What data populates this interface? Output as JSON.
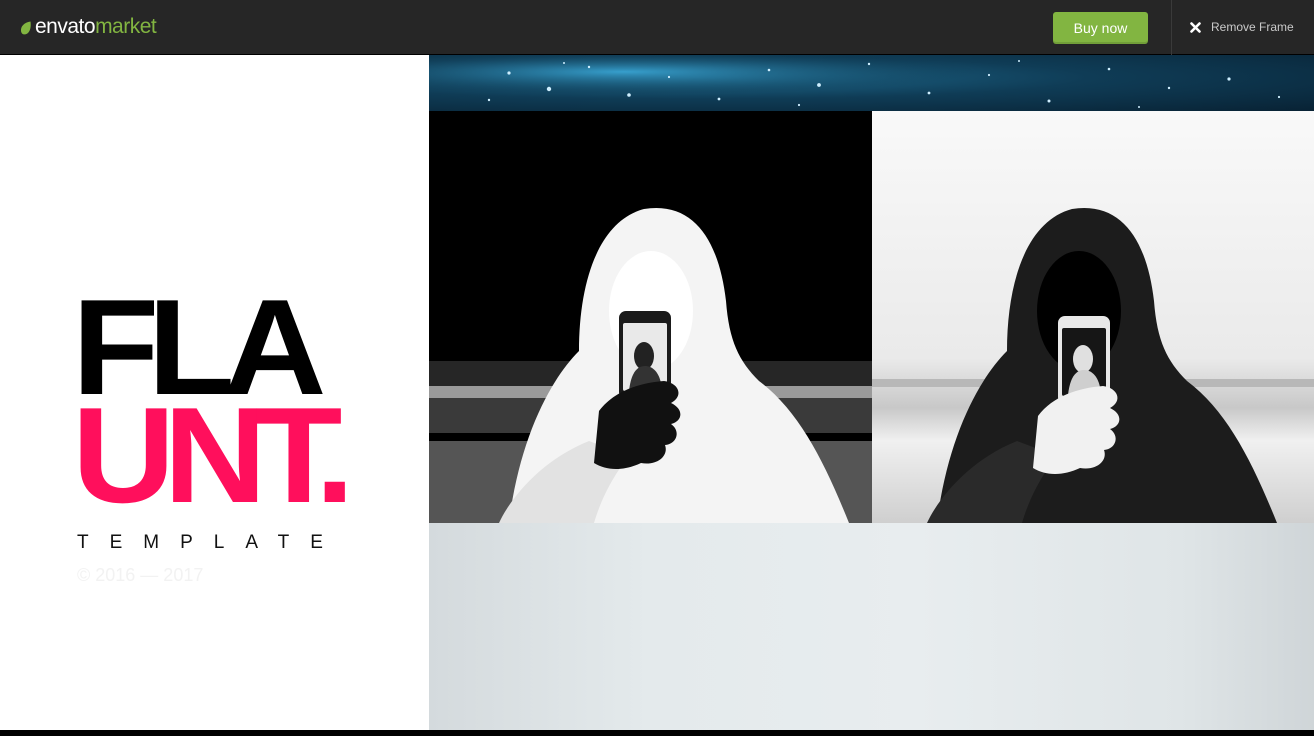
{
  "topbar": {
    "logo_envato": "envato",
    "logo_market": "market",
    "logo_icon": "envato-leaf-icon",
    "buy_label": "Buy now",
    "remove_frame_label": "Remove Frame",
    "remove_frame_icon": "close-icon"
  },
  "brand": {
    "line1": "FLA",
    "line2": "UNT.",
    "tagline": "TEMPLATE",
    "copyright": "© 2016 — 2017"
  },
  "colors": {
    "topbar_bg": "#262626",
    "accent_green": "#82b541",
    "brand_pink": "#ff0f5c",
    "brand_black": "#000000"
  },
  "gallery": {
    "tiles": [
      {
        "kind": "photo",
        "subject": "blue starry sky"
      },
      {
        "kind": "photo",
        "subject": "hooded person holding phone (inverted)"
      },
      {
        "kind": "photo",
        "subject": "hooded person holding phone"
      },
      {
        "kind": "photo",
        "subject": "pale grey sky"
      }
    ]
  }
}
